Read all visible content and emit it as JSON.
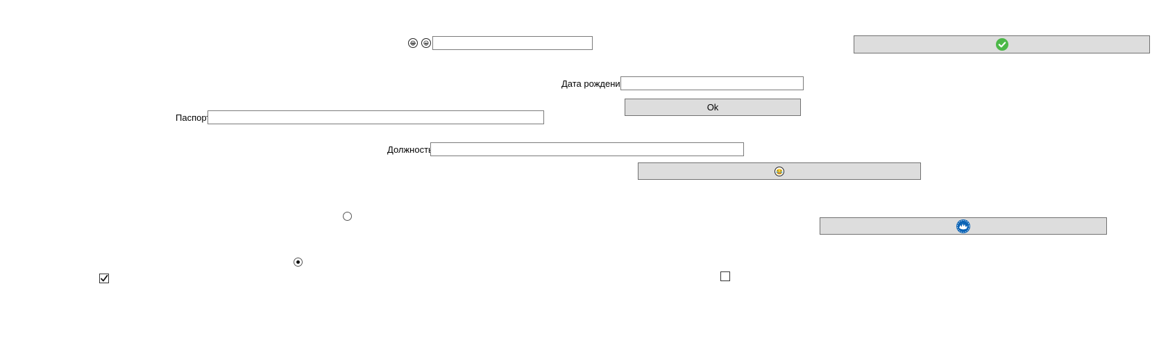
{
  "labels": {
    "birth_date": "Дата рождения",
    "passport": "Паспорт",
    "position": "Должность"
  },
  "fields": {
    "top_field": "",
    "birth_date": "",
    "passport": "",
    "position": ""
  },
  "buttons": {
    "ok_label": "Ok"
  },
  "icons": {
    "top_left": "laughing-face-icon",
    "top_right": "grinning-face-icon",
    "check_button": "green-check-icon",
    "emoji_button": "laughing-face-icon",
    "blue_button": "blue-badge-icon"
  },
  "controls": {
    "radio_1_checked": false,
    "radio_2_checked": true,
    "checkbox_1_checked": true,
    "checkbox_2_checked": false
  },
  "colors": {
    "check_green": "#4cb848",
    "blue_badge": "#0b63b5",
    "button_bg": "#dddddd"
  }
}
